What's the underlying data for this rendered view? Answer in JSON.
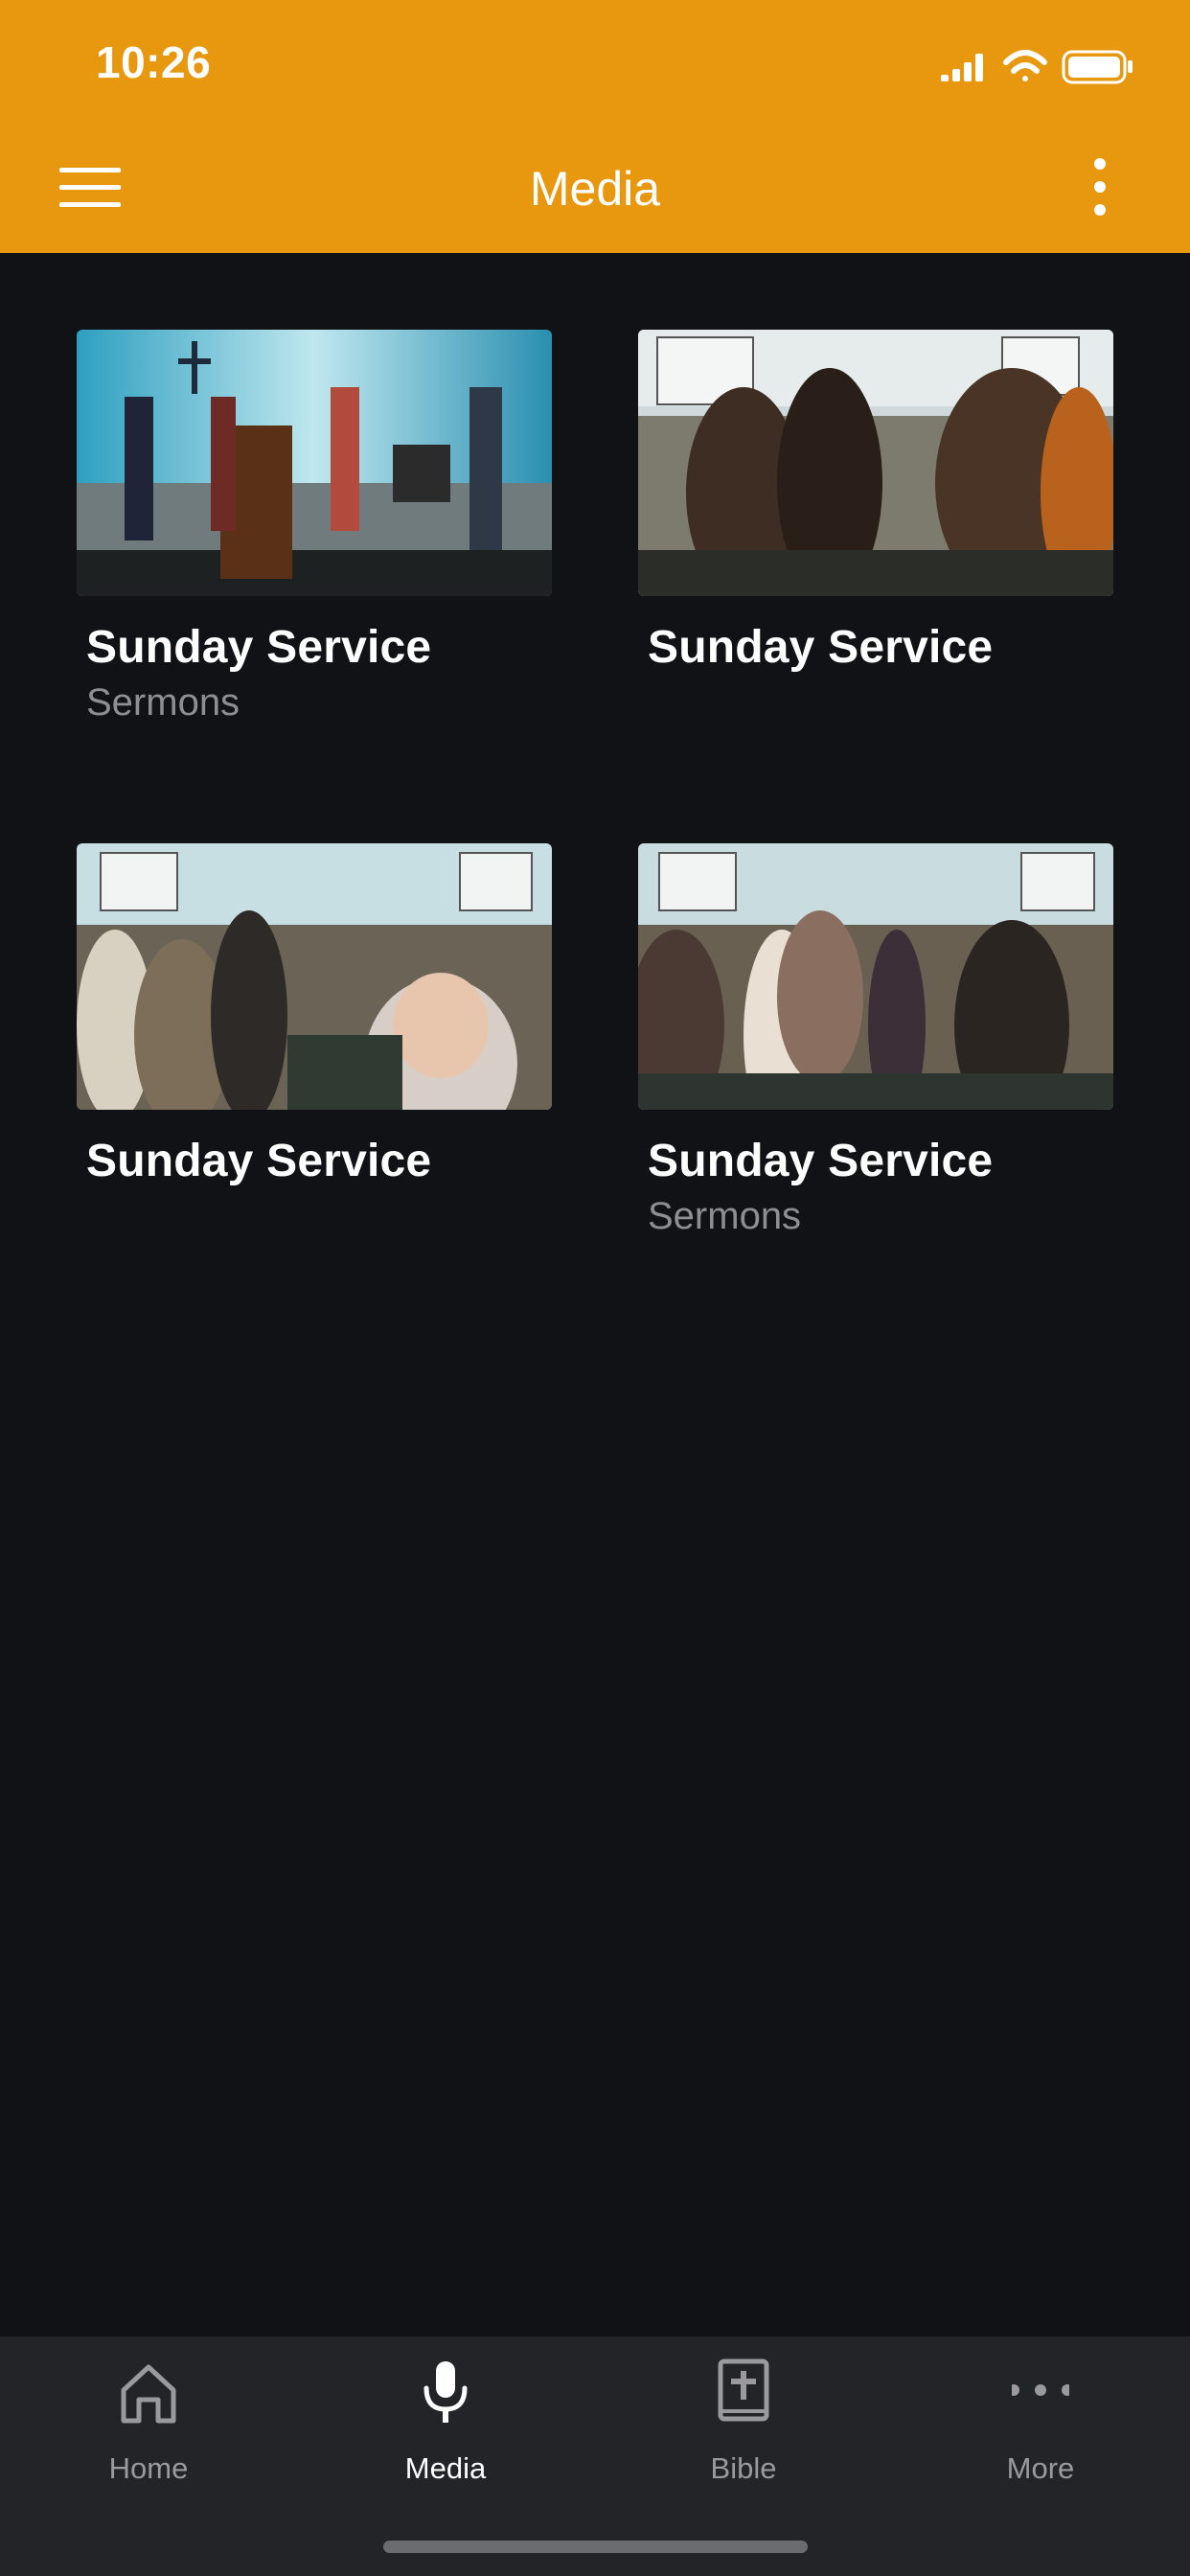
{
  "status_bar": {
    "time": "10:26"
  },
  "app_bar": {
    "title": "Media"
  },
  "colors": {
    "accent": "#E8980E",
    "background": "#111215",
    "tab_bar": "#232427"
  },
  "media_items": [
    {
      "title": "Sunday Service",
      "subtitle": "Sermons"
    },
    {
      "title": "Sunday Service",
      "subtitle": ""
    },
    {
      "title": "Sunday Service",
      "subtitle": ""
    },
    {
      "title": "Sunday Service",
      "subtitle": "Sermons"
    }
  ],
  "tabs": [
    {
      "label": "Home",
      "icon": "home-icon",
      "active": false
    },
    {
      "label": "Media",
      "icon": "microphone-icon",
      "active": true
    },
    {
      "label": "Bible",
      "icon": "bible-icon",
      "active": false
    },
    {
      "label": "More",
      "icon": "more-icon",
      "active": false
    }
  ]
}
